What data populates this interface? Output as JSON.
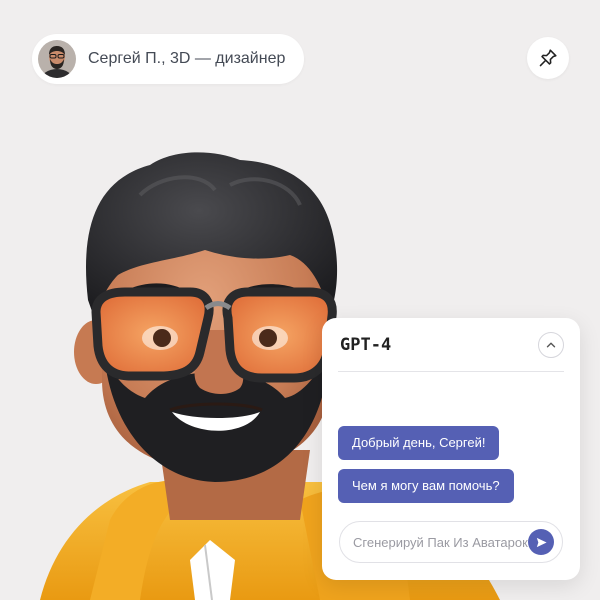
{
  "profile": {
    "name": "Сергей П., 3D — дизайнер",
    "avatar_icon": "person-avatar-photo"
  },
  "pin": {
    "icon": "pin-icon"
  },
  "illustration": {
    "subject": "3d-avatar-bearded-man-orange-glasses-yellow-hoodie"
  },
  "chat": {
    "title": "GPT-4",
    "collapse_icon": "chevron-up-icon",
    "messages": [
      {
        "text": "Добрый день, Сергей!"
      },
      {
        "text": "Чем я могу вам помочь?"
      }
    ],
    "input": {
      "placeholder": "Сгенерируй Пак Из Аватарок",
      "value": ""
    },
    "send_icon": "send-icon"
  },
  "colors": {
    "background": "#f0eeee",
    "accent": "#5560b4",
    "hoodie": "#f5b224",
    "lens": "#ef8a4a",
    "hair": "#2b2b2d"
  }
}
